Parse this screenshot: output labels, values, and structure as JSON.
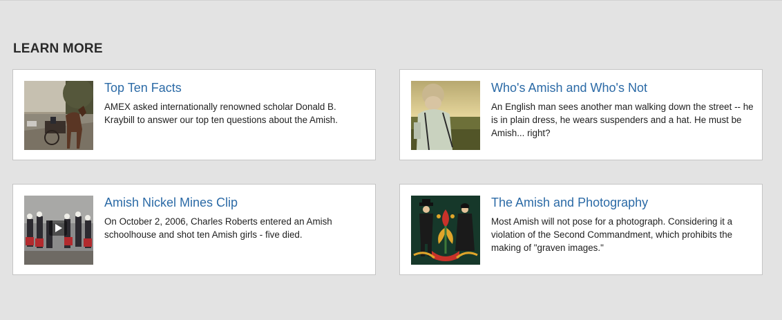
{
  "section": {
    "title": "LEARN MORE"
  },
  "cards": [
    {
      "title": "Top Ten Facts",
      "description": "AMEX asked internationally renowned scholar Donald B. Kraybill to answer our top ten questions about the Amish.",
      "image_icon": "horse-buggy-image"
    },
    {
      "title": "Who's Amish and Who's Not",
      "description": "An English man sees another man walking down the street -- he is in plain dress, he wears suspenders and a hat. He must be Amish... right?",
      "image_icon": "boy-in-field-image"
    },
    {
      "title": "Amish Nickel Mines Clip",
      "description": "On October 2, 2006, Charles Roberts entered an Amish schoolhouse and shot ten Amish girls - five died.",
      "image_icon": "video-clip-image"
    },
    {
      "title": "The Amish and Photography",
      "description": "Most Amish will not pose for a photograph. Considering it a violation of the Second Commandment, which prohibits the making of \"graven images.\"",
      "image_icon": "folk-art-couple-image"
    }
  ],
  "colors": {
    "background": "#e3e3e3",
    "card_border": "#c4c4c4",
    "link": "#2b6aa6",
    "heading": "#2a2a2a"
  }
}
